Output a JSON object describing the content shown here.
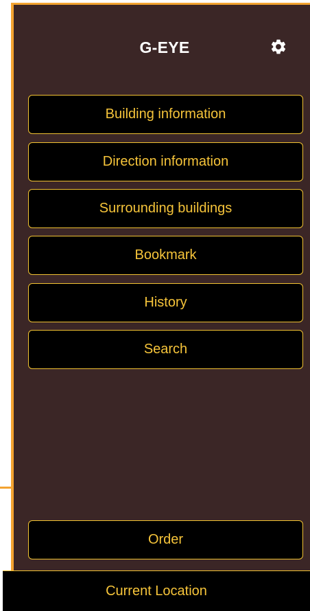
{
  "app": {
    "title": "G-EYE"
  },
  "menu": {
    "items": [
      {
        "label": "Building information"
      },
      {
        "label": "Direction information"
      },
      {
        "label": "Surrounding buildings"
      },
      {
        "label": "Bookmark"
      },
      {
        "label": "History"
      },
      {
        "label": "Search"
      }
    ]
  },
  "order": {
    "label": "Order"
  },
  "bottom_bar": {
    "label": "Current Location"
  },
  "colors": {
    "accent": "#f3a331",
    "button_text": "#f6c43a",
    "drawer_background": "#3b2626",
    "button_background": "#000000"
  },
  "icons": {
    "settings": "gear-icon"
  }
}
